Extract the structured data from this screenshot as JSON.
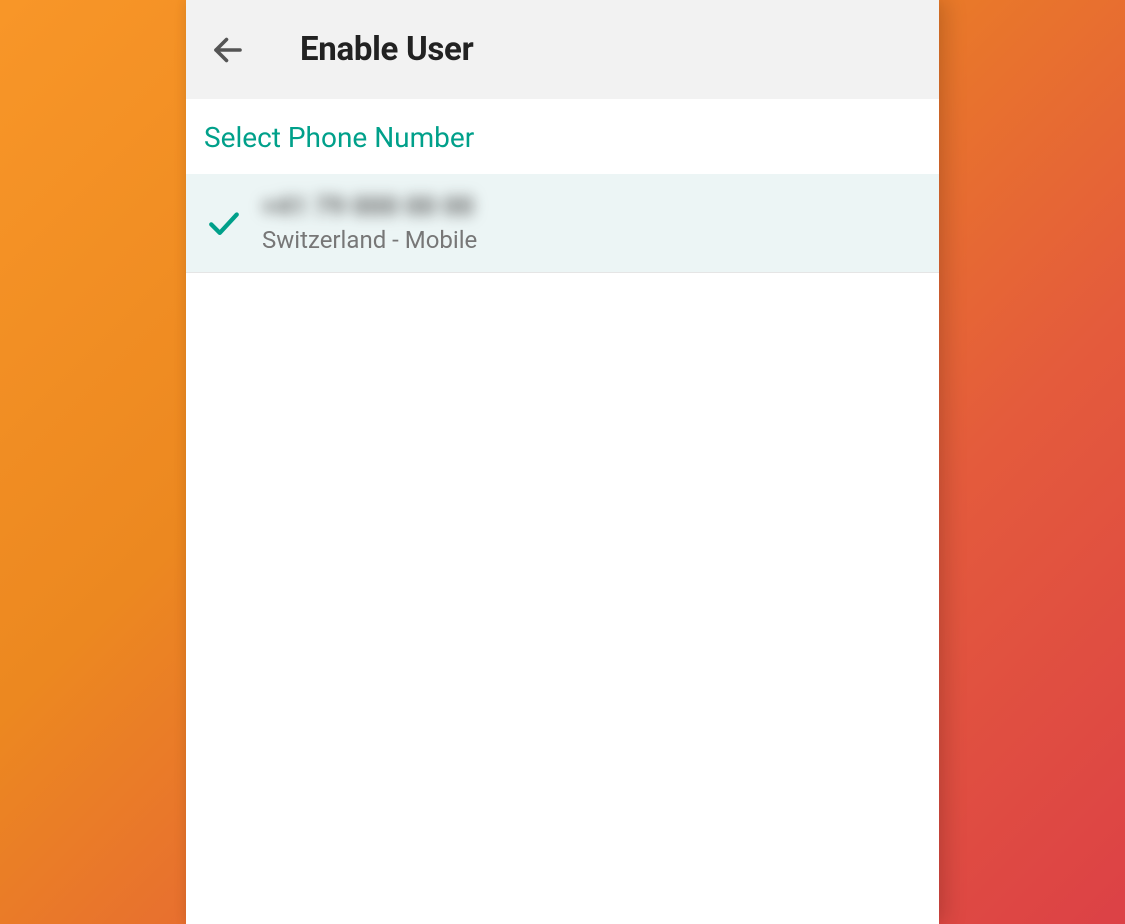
{
  "header": {
    "title": "Enable User"
  },
  "section": {
    "label": "Select Phone Number"
  },
  "phones": [
    {
      "number_obfuscated": "+41 79 000 00 00",
      "type": "Switzerland - Mobile",
      "selected": true
    }
  ]
}
